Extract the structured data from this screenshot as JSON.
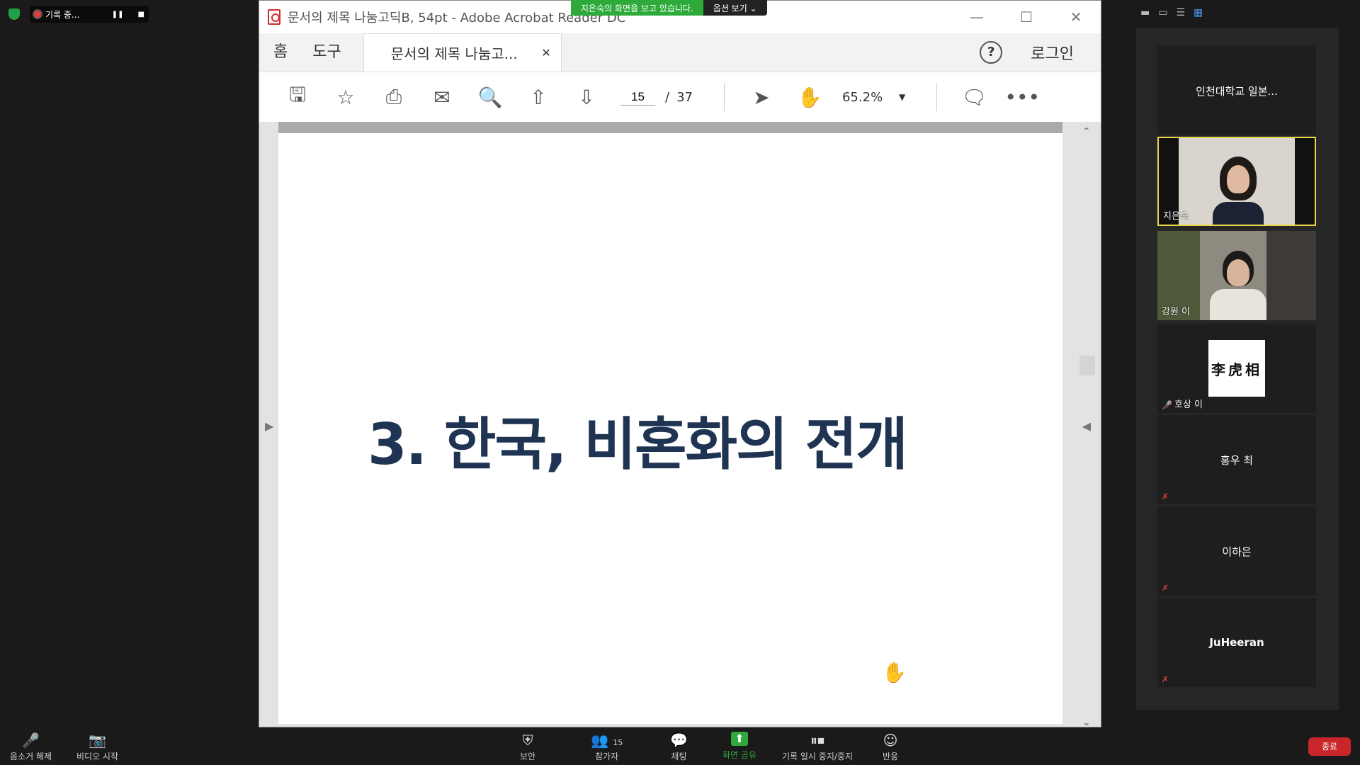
{
  "recording": {
    "label": "기록 중..."
  },
  "banner": {
    "text": "지은숙의 화면을 보고 있습니다.",
    "options": "옵션 보기 ⌄"
  },
  "window": {
    "title": "문서의 제목 나눔고딕B, 54pt - Adobe Acrobat Reader DC",
    "nav_home": "홈",
    "nav_tools": "도구",
    "doc_tab": "문서의 제목 나눔고...",
    "login": "로그인",
    "page_current": "15",
    "page_total": "37",
    "zoom": "65.2%"
  },
  "slide": {
    "title": "3. 한국, 비혼화의 전개"
  },
  "panel": {
    "tiles": [
      {
        "name": "인천대학교 일본..."
      },
      {
        "name": "지은숙"
      },
      {
        "name": "강원 이"
      },
      {
        "name": "호상 이",
        "badge": "李虎相"
      },
      {
        "name": "홍우 최"
      },
      {
        "name": "이하은"
      },
      {
        "name": "JuHeeran"
      }
    ]
  },
  "bottom": {
    "mute": "음소거 해제",
    "video": "비디오 시작",
    "security": "보안",
    "participants": "참가자",
    "participants_count": "15",
    "chat": "채팅",
    "share": "화면 공유",
    "record": "기록 일시 중지/중지",
    "reactions": "반응",
    "end": "종료"
  },
  "colors": {
    "accent_green": "#2eaa3a",
    "end_red": "#c8262b",
    "slide_title": "#1f3352",
    "active_speaker": "#e8d64a"
  }
}
